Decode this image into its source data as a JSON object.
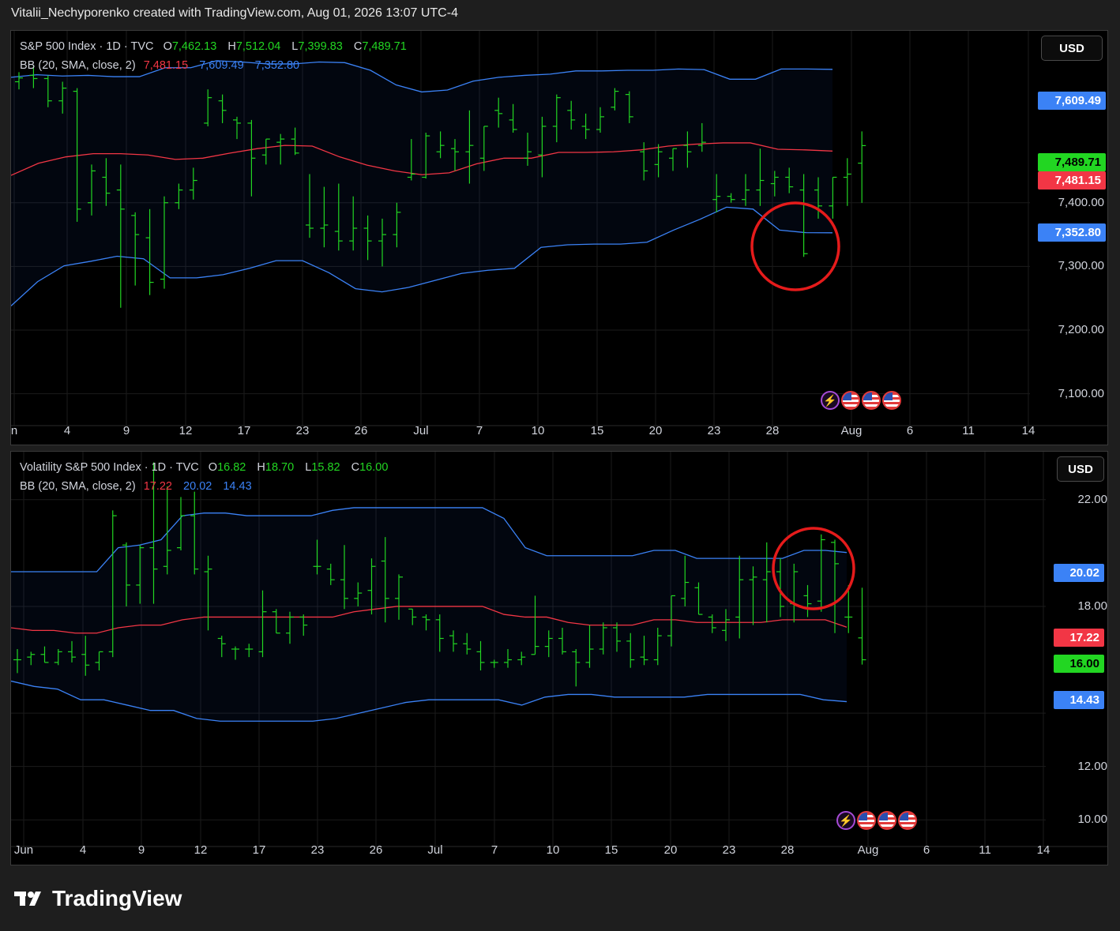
{
  "header": {
    "text": "Vitalii_Nechyporenko created with TradingView.com, Aug 01, 2026 13:07 UTC-4"
  },
  "brand": {
    "name": "TradingView"
  },
  "colors": {
    "up": "#22d622",
    "bb_basis": "#f23645",
    "bb_band": "#3b82f6",
    "circle": "#e51b1b"
  },
  "icons": [
    "lightning-icon",
    "us-flag-icon",
    "us-flag-icon",
    "us-flag-icon"
  ],
  "panes": [
    {
      "symbol": "S&P 500 Index · 1D · TVC",
      "o_label": "O",
      "o": "7,462.13",
      "h_label": "H",
      "h": "7,512.04",
      "l_label": "L",
      "l": "7,399.83",
      "c_label": "C",
      "c": "7,489.71",
      "bb_label": "BB (20, SMA, close, 2)",
      "bb_basis": "7,481.15",
      "bb_upper": "7,609.49",
      "bb_lower": "7,352.80",
      "currency": "USD",
      "x_labels": [
        "n",
        "4",
        "9",
        "12",
        "17",
        "23",
        "26",
        "Jul",
        "7",
        "10",
        "15",
        "20",
        "23",
        "28",
        "Aug",
        "6",
        "11",
        "14"
      ],
      "y_labels": [
        "7,400.00",
        "7,300.00",
        "7,200.00",
        "7,100.00"
      ],
      "badges": {
        "upper": "7,609.49",
        "last": "7,489.71",
        "basis": "7,481.15",
        "lower": "7,352.80"
      }
    },
    {
      "symbol": "Volatility S&P 500 Index · 1D · TVC",
      "o_label": "O",
      "o": "16.82",
      "h_label": "H",
      "h": "18.70",
      "l_label": "L",
      "l": "15.82",
      "c_label": "C",
      "c": "16.00",
      "bb_label": "BB (20, SMA, close, 2)",
      "bb_basis": "17.22",
      "bb_upper": "20.02",
      "bb_lower": "14.43",
      "currency": "USD",
      "x_labels": [
        "Jun",
        "4",
        "9",
        "12",
        "17",
        "23",
        "26",
        "Jul",
        "7",
        "10",
        "15",
        "20",
        "23",
        "28",
        "Aug",
        "6",
        "11",
        "14"
      ],
      "y_labels": [
        "22.00",
        "18.00",
        "12.00",
        "10.00"
      ],
      "badges": {
        "upper": "20.02",
        "basis": "17.22",
        "last": "16.00",
        "lower": "14.43"
      }
    }
  ],
  "chart_data": [
    {
      "type": "ohlc",
      "title": "S&P 500 Index · 1D · TVC",
      "ylim": [
        7050,
        7670
      ],
      "y_ticks": [
        7100,
        7200,
        7300,
        7400
      ],
      "indicator": "Bollinger Bands (20, SMA, close, 2)",
      "x_tick_dates": [
        "Jun 1",
        "Jun 4",
        "Jun 9",
        "Jun 12",
        "Jun 17",
        "Jun 23",
        "Jun 26",
        "Jul 1",
        "Jul 7",
        "Jul 10",
        "Jul 15",
        "Jul 20",
        "Jul 23",
        "Jul 28",
        "Aug 1",
        "Aug 6",
        "Aug 11",
        "Aug 14"
      ],
      "bars": [
        {
          "o": 7590,
          "h": 7605,
          "l": 7578,
          "c": 7596
        },
        {
          "o": 7600,
          "h": 7615,
          "l": 7580,
          "c": 7595
        },
        {
          "o": 7595,
          "h": 7600,
          "l": 7550,
          "c": 7560
        },
        {
          "o": 7560,
          "h": 7590,
          "l": 7540,
          "c": 7580
        },
        {
          "o": 7575,
          "h": 7580,
          "l": 7370,
          "c": 7390
        },
        {
          "o": 7400,
          "h": 7460,
          "l": 7380,
          "c": 7450
        },
        {
          "o": 7440,
          "h": 7470,
          "l": 7395,
          "c": 7415
        },
        {
          "o": 7420,
          "h": 7460,
          "l": 7235,
          "c": 7390
        },
        {
          "o": 7380,
          "h": 7385,
          "l": 7270,
          "c": 7350
        },
        {
          "o": 7345,
          "h": 7390,
          "l": 7255,
          "c": 7275
        },
        {
          "o": 7280,
          "h": 7410,
          "l": 7265,
          "c": 7400
        },
        {
          "o": 7400,
          "h": 7430,
          "l": 7390,
          "c": 7420
        },
        {
          "o": 7420,
          "h": 7455,
          "l": 7405,
          "c": 7435
        },
        {
          "o": 7525,
          "h": 7578,
          "l": 7520,
          "c": 7565
        },
        {
          "o": 7560,
          "h": 7570,
          "l": 7525,
          "c": 7545
        },
        {
          "o": 7530,
          "h": 7535,
          "l": 7500,
          "c": 7525
        },
        {
          "o": 7525,
          "h": 7530,
          "l": 7410,
          "c": 7470
        },
        {
          "o": 7475,
          "h": 7500,
          "l": 7460,
          "c": 7500
        },
        {
          "o": 7495,
          "h": 7508,
          "l": 7460,
          "c": 7500
        },
        {
          "o": 7500,
          "h": 7518,
          "l": 7475,
          "c": 7478
        },
        {
          "o": 7365,
          "h": 7445,
          "l": 7345,
          "c": 7360
        },
        {
          "o": 7360,
          "h": 7425,
          "l": 7330,
          "c": 7365
        },
        {
          "o": 7355,
          "h": 7430,
          "l": 7325,
          "c": 7340
        },
        {
          "o": 7340,
          "h": 7410,
          "l": 7325,
          "c": 7360
        },
        {
          "o": 7360,
          "h": 7380,
          "l": 7310,
          "c": 7340
        },
        {
          "o": 7340,
          "h": 7375,
          "l": 7300,
          "c": 7350
        },
        {
          "o": 7350,
          "h": 7400,
          "l": 7330,
          "c": 7385
        },
        {
          "o": 7440,
          "h": 7500,
          "l": 7435,
          "c": 7445
        },
        {
          "o": 7440,
          "h": 7510,
          "l": 7438,
          "c": 7505
        },
        {
          "o": 7480,
          "h": 7512,
          "l": 7470,
          "c": 7490
        },
        {
          "o": 7485,
          "h": 7500,
          "l": 7450,
          "c": 7480
        },
        {
          "o": 7480,
          "h": 7545,
          "l": 7430,
          "c": 7490
        },
        {
          "o": 7470,
          "h": 7520,
          "l": 7450,
          "c": 7520
        },
        {
          "o": 7545,
          "h": 7565,
          "l": 7518,
          "c": 7540
        },
        {
          "o": 7530,
          "h": 7555,
          "l": 7510,
          "c": 7515
        },
        {
          "o": 7470,
          "h": 7510,
          "l": 7458,
          "c": 7480
        },
        {
          "o": 7475,
          "h": 7535,
          "l": 7440,
          "c": 7520
        },
        {
          "o": 7520,
          "h": 7570,
          "l": 7495,
          "c": 7565
        },
        {
          "o": 7545,
          "h": 7560,
          "l": 7515,
          "c": 7530
        },
        {
          "o": 7520,
          "h": 7540,
          "l": 7500,
          "c": 7515
        },
        {
          "o": 7515,
          "h": 7550,
          "l": 7510,
          "c": 7535
        },
        {
          "o": 7550,
          "h": 7580,
          "l": 7545,
          "c": 7575
        },
        {
          "o": 7570,
          "h": 7575,
          "l": 7525,
          "c": 7535
        },
        {
          "o": 7480,
          "h": 7495,
          "l": 7435,
          "c": 7450
        },
        {
          "o": 7460,
          "h": 7492,
          "l": 7440,
          "c": 7480
        },
        {
          "o": 7470,
          "h": 7485,
          "l": 7450,
          "c": 7485
        },
        {
          "o": 7490,
          "h": 7512,
          "l": 7455,
          "c": 7480
        },
        {
          "o": 7490,
          "h": 7525,
          "l": 7480,
          "c": 7495
        },
        {
          "o": 7405,
          "h": 7445,
          "l": 7385,
          "c": 7410
        },
        {
          "o": 7410,
          "h": 7415,
          "l": 7400,
          "c": 7405
        },
        {
          "o": 7405,
          "h": 7445,
          "l": 7395,
          "c": 7420
        },
        {
          "o": 7420,
          "h": 7485,
          "l": 7395,
          "c": 7435
        },
        {
          "o": 7430,
          "h": 7450,
          "l": 7410,
          "c": 7440
        },
        {
          "o": 7440,
          "h": 7455,
          "l": 7415,
          "c": 7425
        },
        {
          "o": 7420,
          "h": 7445,
          "l": 7315,
          "c": 7320
        },
        {
          "o": 7420,
          "h": 7440,
          "l": 7375,
          "c": 7395
        },
        {
          "o": 7395,
          "h": 7440,
          "l": 7375,
          "c": 7440
        },
        {
          "o": 7440,
          "h": 7470,
          "l": 7395,
          "c": 7445
        },
        {
          "o": 7462.13,
          "h": 7512.04,
          "l": 7399.83,
          "c": 7489.71
        }
      ],
      "bb_upper": [
        7597,
        7601,
        7599,
        7600,
        7598,
        7598,
        7612,
        7612,
        7623,
        7621,
        7618,
        7618,
        7621,
        7620,
        7608,
        7585,
        7574,
        7577,
        7591,
        7597,
        7600,
        7602,
        7607,
        7607,
        7608,
        7608,
        7610,
        7609,
        7594,
        7594,
        7610,
        7610,
        7609.49
      ],
      "bb_basis": [
        7443,
        7462,
        7472,
        7477,
        7477,
        7475,
        7468,
        7470,
        7478,
        7485,
        7490,
        7489,
        7472,
        7459,
        7450,
        7444,
        7447,
        7461,
        7470,
        7470,
        7479,
        7479,
        7480,
        7483,
        7489,
        7492,
        7494,
        7494,
        7484,
        7483,
        7481.15
      ],
      "bb_lower": [
        7238,
        7276,
        7301,
        7308,
        7316,
        7312,
        7282,
        7282,
        7287,
        7297,
        7309,
        7309,
        7290,
        7265,
        7260,
        7267,
        7278,
        7289,
        7294,
        7297,
        7330,
        7334,
        7335,
        7335,
        7338,
        7357,
        7374,
        7393,
        7390,
        7357,
        7353,
        7352.8
      ]
    },
    {
      "type": "ohlc",
      "title": "Volatility S&P 500 Index · 1D · TVC",
      "ylim": [
        9.0,
        23.8
      ],
      "y_ticks": [
        10,
        12,
        14,
        18,
        22
      ],
      "indicator": "Bollinger Bands (20, SMA, close, 2)",
      "x_tick_dates": [
        "Jun 1",
        "Jun 4",
        "Jun 9",
        "Jun 12",
        "Jun 17",
        "Jun 23",
        "Jun 26",
        "Jul 1",
        "Jul 7",
        "Jul 10",
        "Jul 15",
        "Jul 20",
        "Jul 23",
        "Jul 28",
        "Aug 1",
        "Aug 6",
        "Aug 11",
        "Aug 14"
      ],
      "bars": [
        {
          "o": 16.0,
          "h": 16.4,
          "l": 15.5,
          "c": 16.0
        },
        {
          "o": 16.1,
          "h": 16.3,
          "l": 15.8,
          "c": 16.2
        },
        {
          "o": 16.2,
          "h": 16.5,
          "l": 15.9,
          "c": 15.9
        },
        {
          "o": 15.9,
          "h": 16.4,
          "l": 15.8,
          "c": 16.3
        },
        {
          "o": 16.3,
          "h": 16.7,
          "l": 15.9,
          "c": 16.1
        },
        {
          "o": 16.2,
          "h": 16.9,
          "l": 15.4,
          "c": 15.8
        },
        {
          "o": 15.9,
          "h": 16.3,
          "l": 15.6,
          "c": 16.3
        },
        {
          "o": 16.3,
          "h": 21.6,
          "l": 16.1,
          "c": 21.4
        },
        {
          "o": 20.3,
          "h": 20.4,
          "l": 18.0,
          "c": 18.8
        },
        {
          "o": 18.8,
          "h": 20.3,
          "l": 18.1,
          "c": 20.2
        },
        {
          "o": 20.2,
          "h": 23.4,
          "l": 18.1,
          "c": 19.4
        },
        {
          "o": 19.5,
          "h": 22.5,
          "l": 19.2,
          "c": 20.1
        },
        {
          "o": 20.2,
          "h": 22.1,
          "l": 20.1,
          "c": 21.4
        },
        {
          "o": 21.4,
          "h": 22.3,
          "l": 19.2,
          "c": 19.4
        },
        {
          "o": 19.3,
          "h": 19.9,
          "l": 17.1,
          "c": 19.4
        },
        {
          "o": 16.8,
          "h": 16.9,
          "l": 16.1,
          "c": 16.6
        },
        {
          "o": 16.4,
          "h": 16.5,
          "l": 16.0,
          "c": 16.4
        },
        {
          "o": 16.4,
          "h": 16.6,
          "l": 16.1,
          "c": 16.4
        },
        {
          "o": 16.3,
          "h": 18.6,
          "l": 16.1,
          "c": 17.8
        },
        {
          "o": 17.8,
          "h": 17.9,
          "l": 17.0,
          "c": 17.0
        },
        {
          "o": 17.0,
          "h": 17.8,
          "l": 16.6,
          "c": 17.6
        },
        {
          "o": 17.6,
          "h": 17.7,
          "l": 16.9,
          "c": 17.3
        },
        {
          "o": 19.5,
          "h": 20.5,
          "l": 19.2,
          "c": 19.5
        },
        {
          "o": 19.4,
          "h": 19.6,
          "l": 18.8,
          "c": 19.0
        },
        {
          "o": 19.0,
          "h": 20.3,
          "l": 17.9,
          "c": 18.3
        },
        {
          "o": 18.3,
          "h": 18.9,
          "l": 18.0,
          "c": 18.5
        },
        {
          "o": 18.6,
          "h": 19.8,
          "l": 17.7,
          "c": 19.5
        },
        {
          "o": 19.7,
          "h": 20.6,
          "l": 17.4,
          "c": 18.3
        },
        {
          "o": 18.3,
          "h": 19.2,
          "l": 17.5,
          "c": 19.1
        },
        {
          "o": 17.9,
          "h": 17.9,
          "l": 17.3,
          "c": 17.6
        },
        {
          "o": 17.6,
          "h": 17.7,
          "l": 17.1,
          "c": 17.5
        },
        {
          "o": 17.5,
          "h": 17.7,
          "l": 16.3,
          "c": 16.8
        },
        {
          "o": 16.9,
          "h": 17.1,
          "l": 16.3,
          "c": 16.6
        },
        {
          "o": 16.6,
          "h": 17.0,
          "l": 16.2,
          "c": 16.4
        },
        {
          "o": 16.3,
          "h": 16.7,
          "l": 15.6,
          "c": 15.9
        },
        {
          "o": 15.9,
          "h": 16.0,
          "l": 15.7,
          "c": 15.9
        },
        {
          "o": 15.9,
          "h": 16.4,
          "l": 15.7,
          "c": 16.0
        },
        {
          "o": 16.0,
          "h": 16.3,
          "l": 15.8,
          "c": 16.1
        },
        {
          "o": 16.2,
          "h": 18.4,
          "l": 16.2,
          "c": 16.5
        },
        {
          "o": 16.5,
          "h": 17.1,
          "l": 16.1,
          "c": 16.8
        },
        {
          "o": 16.8,
          "h": 17.2,
          "l": 16.2,
          "c": 16.3
        },
        {
          "o": 16.3,
          "h": 16.4,
          "l": 15.0,
          "c": 15.9
        },
        {
          "o": 15.9,
          "h": 17.3,
          "l": 15.7,
          "c": 16.4
        },
        {
          "o": 16.4,
          "h": 17.4,
          "l": 16.2,
          "c": 17.2
        },
        {
          "o": 17.2,
          "h": 17.4,
          "l": 16.3,
          "c": 16.7
        },
        {
          "o": 16.7,
          "h": 17.0,
          "l": 15.7,
          "c": 16.0
        },
        {
          "o": 16.1,
          "h": 16.9,
          "l": 15.8,
          "c": 16.0
        },
        {
          "o": 16.0,
          "h": 17.2,
          "l": 15.8,
          "c": 16.9
        },
        {
          "o": 16.9,
          "h": 18.4,
          "l": 16.5,
          "c": 18.4
        },
        {
          "o": 18.3,
          "h": 19.9,
          "l": 18.0,
          "c": 18.9
        },
        {
          "o": 18.7,
          "h": 18.9,
          "l": 17.7,
          "c": 17.7
        },
        {
          "o": 17.6,
          "h": 17.7,
          "l": 17.0,
          "c": 17.2
        },
        {
          "o": 17.1,
          "h": 17.9,
          "l": 16.7,
          "c": 17.5
        },
        {
          "o": 17.6,
          "h": 19.9,
          "l": 16.8,
          "c": 19.0
        },
        {
          "o": 19.0,
          "h": 19.5,
          "l": 17.3,
          "c": 19.1
        },
        {
          "o": 19.0,
          "h": 20.4,
          "l": 17.4,
          "c": 19.3
        },
        {
          "o": 19.3,
          "h": 19.8,
          "l": 17.6,
          "c": 18.0
        },
        {
          "o": 18.1,
          "h": 19.6,
          "l": 17.4,
          "c": 19.3
        },
        {
          "o": 18.4,
          "h": 18.8,
          "l": 17.6,
          "c": 18.1
        },
        {
          "o": 18.2,
          "h": 20.7,
          "l": 17.8,
          "c": 20.5
        },
        {
          "o": 20.4,
          "h": 20.5,
          "l": 17.0,
          "c": 19.6
        },
        {
          "o": 17.6,
          "h": 18.8,
          "l": 17.0,
          "c": 17.6
        },
        {
          "o": 16.82,
          "h": 18.7,
          "l": 15.82,
          "c": 16.0
        }
      ],
      "bb_upper": [
        19.3,
        19.3,
        19.3,
        19.3,
        19.3,
        20.2,
        20.3,
        20.5,
        21.4,
        21.5,
        21.5,
        21.4,
        21.4,
        21.4,
        21.4,
        21.6,
        21.7,
        21.7,
        21.7,
        21.7,
        21.7,
        21.7,
        21.7,
        21.3,
        20.2,
        19.9,
        19.9,
        19.9,
        19.9,
        19.9,
        20.1,
        20.1,
        19.8,
        19.8,
        19.8,
        19.8,
        19.8,
        20.1,
        20.1,
        20.02
      ],
      "bb_basis": [
        17.2,
        17.1,
        17.1,
        17.0,
        17.0,
        17.2,
        17.3,
        17.3,
        17.5,
        17.6,
        17.6,
        17.6,
        17.6,
        17.6,
        17.6,
        17.6,
        17.8,
        17.9,
        18.0,
        18.0,
        18.0,
        18.0,
        18.0,
        17.7,
        17.6,
        17.6,
        17.4,
        17.3,
        17.3,
        17.3,
        17.5,
        17.5,
        17.4,
        17.4,
        17.4,
        17.4,
        17.5,
        17.5,
        17.5,
        17.22
      ],
      "bb_lower": [
        15.2,
        15.0,
        14.9,
        14.5,
        14.5,
        14.3,
        14.1,
        14.1,
        13.8,
        13.7,
        13.7,
        13.7,
        13.7,
        13.7,
        13.8,
        14.0,
        14.2,
        14.4,
        14.5,
        14.5,
        14.5,
        14.5,
        14.3,
        14.6,
        14.7,
        14.7,
        14.6,
        14.6,
        14.6,
        14.6,
        14.7,
        14.7,
        14.7,
        14.7,
        14.7,
        14.5,
        14.43
      ]
    }
  ]
}
